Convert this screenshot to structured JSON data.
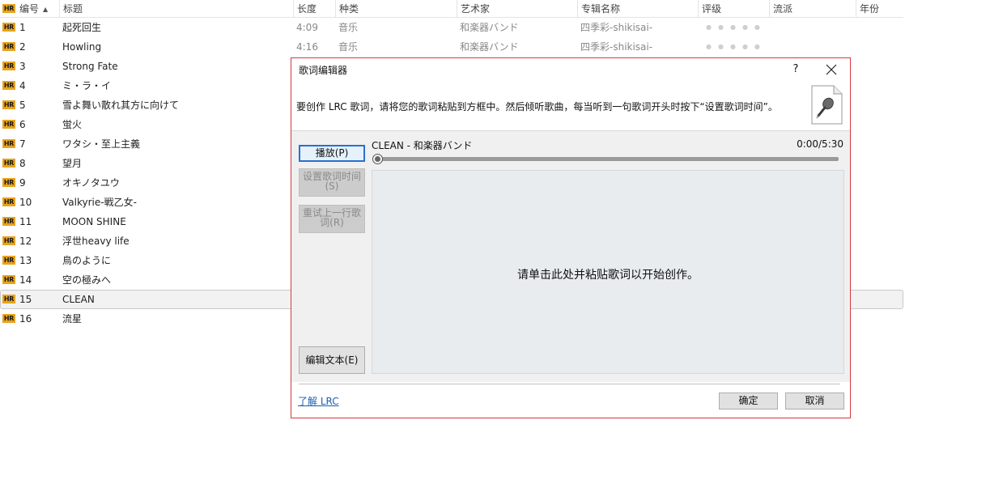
{
  "columns": {
    "number": "编号",
    "title": "标题",
    "length": "长度",
    "genre": "种类",
    "artist": "艺术家",
    "album": "专辑名称",
    "rating": "评级",
    "style": "流派",
    "year": "年份"
  },
  "hr_badge": "HR",
  "rating_dots": "●●●●●",
  "tracks": [
    {
      "no": "1",
      "title": "起死回生",
      "length": "4:09",
      "genre": "音乐",
      "artist": "和楽器バンド",
      "album": "四季彩-shikisai-"
    },
    {
      "no": "2",
      "title": "Howling",
      "length": "4:16",
      "genre": "音乐",
      "artist": "和楽器バンド",
      "album": "四季彩-shikisai-"
    },
    {
      "no": "3",
      "title": "Strong Fate"
    },
    {
      "no": "4",
      "title": "ミ・ラ・イ"
    },
    {
      "no": "5",
      "title": "雪よ舞い散れ其方に向けて"
    },
    {
      "no": "6",
      "title": "蛍火"
    },
    {
      "no": "7",
      "title": "ワタシ・至上主義"
    },
    {
      "no": "8",
      "title": "望月"
    },
    {
      "no": "9",
      "title": "オキノタユウ"
    },
    {
      "no": "10",
      "title": "Valkyrie-戦乙女-"
    },
    {
      "no": "11",
      "title": "MOON SHINE"
    },
    {
      "no": "12",
      "title": "浮世heavy life"
    },
    {
      "no": "13",
      "title": "鳥のように"
    },
    {
      "no": "14",
      "title": "空の極みへ"
    },
    {
      "no": "15",
      "title": "CLEAN"
    },
    {
      "no": "16",
      "title": "流星"
    }
  ],
  "dialog": {
    "title": "歌词编辑器",
    "help": "?",
    "instruction": "要创作 LRC 歌词，请将您的歌词粘贴到方框中。然后倾听歌曲，每当听到一句歌词开头时按下“设置歌词时间”。",
    "play": "播放(P)",
    "set_time_line1": "设置歌词时间",
    "set_time_line2": "(S)",
    "retry_line1": "重试上一行歌",
    "retry_line2": "词(R)",
    "edit_text": "编辑文本(E)",
    "track_info": "CLEAN - 和楽器バンド",
    "time": "0:00/5:30",
    "progress": 0,
    "placeholder": "请单击此处并粘贴歌词以开始创作。",
    "learn_lrc": "了解 LRC",
    "ok": "确定",
    "cancel": "取消"
  },
  "colors": {
    "dialog_border": "#d7373f",
    "focus_border": "#2a6fd1",
    "hr_badge": "#e8a31c",
    "link": "#1a5fb4"
  }
}
